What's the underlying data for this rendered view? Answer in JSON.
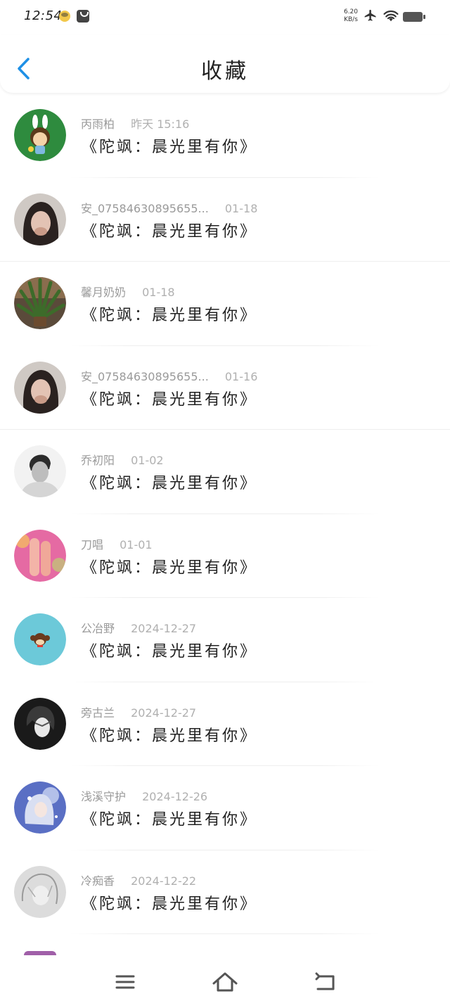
{
  "status_bar": {
    "time": "12:54",
    "net_speed_value": "6.20",
    "net_speed_unit": "KB/s",
    "icons": [
      "emoji-icon",
      "bag-icon",
      "airplane-icon",
      "wifi-icon",
      "battery-icon"
    ]
  },
  "header": {
    "title": "收藏",
    "back_icon": "chevron-left-icon",
    "accent_color": "#1e90e6"
  },
  "favorites": [
    {
      "user": "丙雨柏",
      "time": "昨天 15:16",
      "title": "《陀飒：晨光里有你》",
      "avatar_color": "#2e8b3e"
    },
    {
      "user": "安_07584630895655...",
      "time": "01-18",
      "title": "《陀飒：晨光里有你》",
      "avatar_color": "#cfc9c4"
    },
    {
      "user": "馨月奶奶",
      "time": "01-18",
      "title": "《陀飒：晨光里有你》",
      "avatar_color": "#3f5a2e"
    },
    {
      "user": "安_07584630895655...",
      "time": "01-16",
      "title": "《陀飒：晨光里有你》",
      "avatar_color": "#cfc9c4"
    },
    {
      "user": "乔初阳",
      "time": "01-02",
      "title": "《陀飒：晨光里有你》",
      "avatar_color": "#9a9a9a"
    },
    {
      "user": "刀唱",
      "time": "01-01",
      "title": "《陀飒：晨光里有你》",
      "avatar_color": "#e56aa3"
    },
    {
      "user": "公冶野",
      "time": "2024-12-27",
      "title": "《陀飒：晨光里有你》",
      "avatar_color": "#6cc9d9"
    },
    {
      "user": "旁古兰",
      "time": "2024-12-27",
      "title": "《陀飒：晨光里有你》",
      "avatar_color": "#1a1a1a"
    },
    {
      "user": "浅溪守护",
      "time": "2024-12-26",
      "title": "《陀飒：晨光里有你》",
      "avatar_color": "#5a6fc4"
    },
    {
      "user": "冷痴香",
      "time": "2024-12-22",
      "title": "《陀飒：晨光里有你》",
      "avatar_color": "#dcdcdc"
    }
  ],
  "nav_bar": {
    "icons": [
      "menu-icon",
      "home-icon",
      "back-icon"
    ]
  }
}
